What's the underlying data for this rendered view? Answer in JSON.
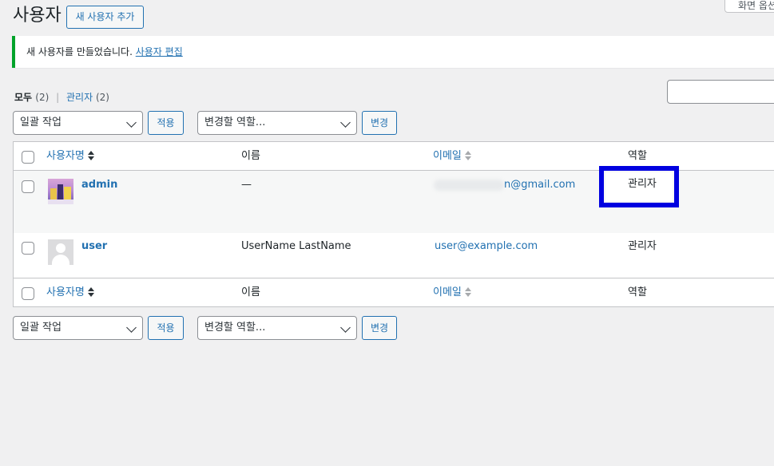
{
  "header": {
    "title": "사용자",
    "add_new_label": "새 사용자 추가",
    "screen_options_label": "화면 옵션"
  },
  "notice": {
    "message": "새 사용자를 만들었습니다.",
    "link_label": "사용자 편집"
  },
  "filters": {
    "all_label": "모두",
    "all_count": "(2)",
    "separator": "|",
    "admin_label": "관리자",
    "admin_count": "(2)"
  },
  "bulk_top": {
    "bulk_action": "일괄 작업",
    "apply_label": "적용",
    "role_change": "변경할 역할...",
    "change_label": "변경"
  },
  "bulk_bottom": {
    "bulk_action": "일괄 작업",
    "apply_label": "적용",
    "role_change": "변경할 역할...",
    "change_label": "변경"
  },
  "table": {
    "columns": {
      "username": "사용자명",
      "name": "이름",
      "email": "이메일",
      "role": "역할"
    },
    "rows": [
      {
        "username": "admin",
        "name": "—",
        "email": "n@gmail.com",
        "role": "관리자",
        "avatar": "city-avatar"
      },
      {
        "username": "user",
        "name": "UserName LastName",
        "email": "user@example.com",
        "role": "관리자",
        "avatar": "default-avatar"
      }
    ]
  },
  "colors": {
    "accent": "#2271b1",
    "success": "#00a32a",
    "highlight": "#0000e0"
  }
}
